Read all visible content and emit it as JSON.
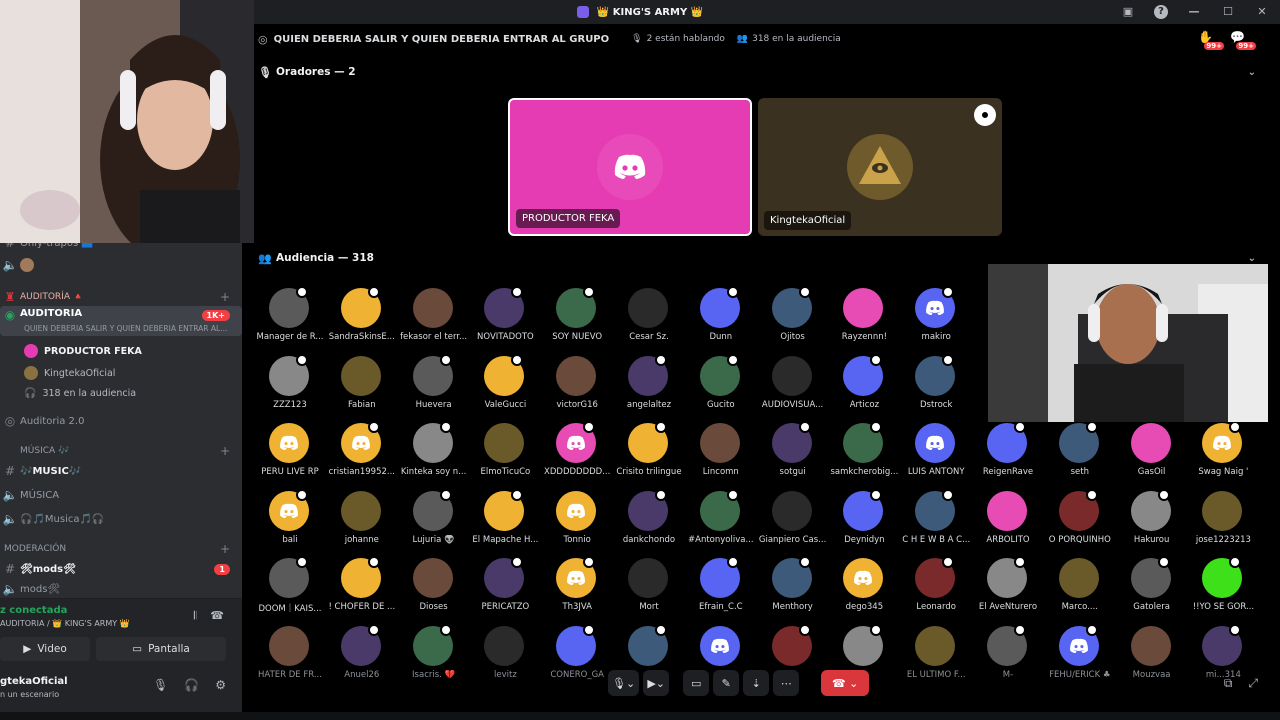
{
  "window": {
    "title": "👑 KING'S ARMY 👑",
    "brand_color": "#5865f2"
  },
  "header": {
    "stage_title": "QUIEN DEBERIA SALIR Y QUIEN DEBERIA ENTRAR AL GRUPO",
    "speaking": "2 están hablando",
    "audience": "318 en la audiencia",
    "badge_1": "99+",
    "badge_2": "99+"
  },
  "speakers": {
    "section_label": "Oradores — 2",
    "tiles": [
      {
        "name": "PRODUCTOR FEKA",
        "color": "#e63cb3"
      },
      {
        "name": "KingtekaOficial",
        "color": "#3b3121"
      }
    ]
  },
  "audience": {
    "section_label": "Audiencia — 318",
    "members": [
      "Manager de R...",
      "SandraSkinsE...",
      "fekasor el terr...",
      "NOVITADOTO",
      "SOY NUEVO",
      "Cesar Sz.",
      "Dunn",
      "Ojitos",
      "Rayzennn!",
      "makiro",
      "ZZZ123",
      "Fabian",
      "Huevera",
      "ValeGucci",
      "victorG16",
      "angelaltez",
      "Gucito",
      "AUDIOVISUA...",
      "Articoz",
      "Dstrock",
      "PERU LIVE RP",
      "cristian19952...",
      "Kinteka soy n...",
      "ElmoTicuCo",
      "XDDDDDDDD...",
      "Crisito trilingue",
      "Lincomn",
      "sotgui",
      "samkcherobig...",
      "LUIS ANTONY",
      "ReigenRave",
      "seth",
      "GasOil",
      "Swag Naig '",
      "bali",
      "johanne",
      "Lujuria 👽",
      "El Mapache H...",
      "Tonnio",
      "dankchondo",
      "#Antonyoliva...",
      "Gianpiero Cas...",
      "Deynidyn",
      "C H E W B A C...",
      "ARBOLITO",
      "O PORQUIÑHO",
      "Hakurou",
      "jose1223213",
      "DOOM｜KAIS...",
      "! CHOFER DE ...",
      "Dioses",
      "PERICATZO",
      "Th3JVA",
      "Mort",
      "Efrain_C.C",
      "Menthory",
      "dego345",
      "Leonardo",
      "El AveNturero",
      "Marco....",
      "Gatolera",
      "!!YO SE GOR...",
      "HATER DE FR...",
      "Anuel26",
      "Isacris. 💔",
      "levitz",
      "CONERO_GA",
      "",
      "",
      "",
      "",
      "EL ULTIMO F...",
      "M-",
      "FEHU/ERICK ♣",
      "Mouzvaa",
      "mi...314"
    ]
  },
  "sidebar": {
    "channel_top": "Only-trapos 🟦",
    "category_auditoria": "AUDITORÍA 🔺",
    "active_channel": "AUDITORIA",
    "active_badge": "1K+",
    "active_sub": "QUIEN DEBERIA SALIR Y QUIEN DEBERIA ENTRAR AL...",
    "users": [
      "PRODUCTOR FEKA",
      "KingtekaOficial",
      "318 en la audiencia"
    ],
    "auditoria2": "Auditoria 2.0",
    "category_musica": "MÚSICA 🎶",
    "music_text": "🎶MUSIC🎶",
    "music_voice": "MÚSICA",
    "music_voice2": "🎧🎵Musica🎵🎧",
    "category_moderacion": "MODERACIÓN",
    "mods_text": "🛠mods🛠",
    "mods_badge": "1",
    "mods_voice": "mods🛠"
  },
  "voice": {
    "status": "z conectada",
    "channel": "AUDITORIA / 👑 KING'S ARMY 👑",
    "video_label": "Video",
    "screen_label": "Pantalla"
  },
  "user": {
    "name": "gtekaOficial",
    "status": "n un escenario"
  }
}
